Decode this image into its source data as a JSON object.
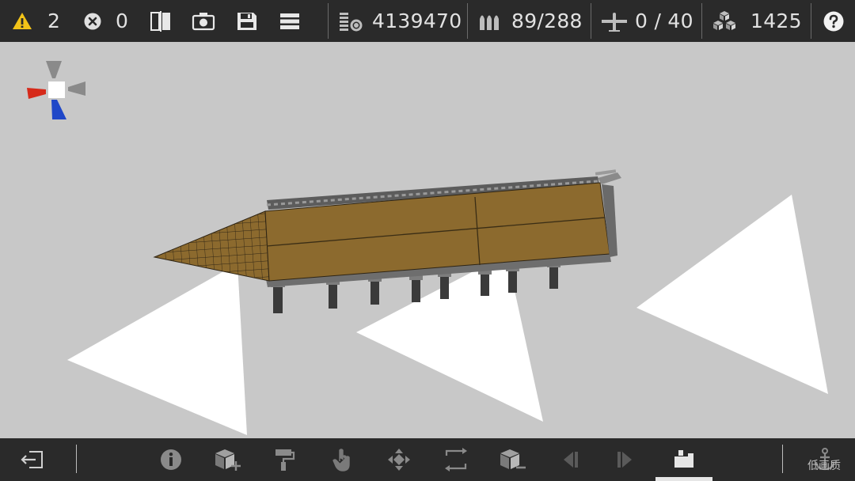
{
  "status": {
    "warnings": "2",
    "errors": "0"
  },
  "stats": {
    "cost": "4139470",
    "ammo": "89/288",
    "aircraft": "0 / 40",
    "blocks": "1425"
  },
  "toolbar_top": {
    "icons": [
      "warning-icon",
      "error-icon",
      "split-view-icon",
      "camera-icon",
      "save-icon",
      "menu-icon",
      "coins-icon",
      "ammo-icon",
      "aircraft-icon",
      "blocks-icon",
      "help-icon"
    ]
  },
  "toolbar_bottom": {
    "icons": [
      "exit-icon",
      "info-icon",
      "add-block-icon",
      "paint-roller-icon",
      "hand-select-icon",
      "move-icon",
      "rotate-icon",
      "remove-block-icon",
      "prev-icon",
      "next-icon",
      "camera-mode-icon",
      "anchor-icon"
    ],
    "active": "camera-mode-icon"
  },
  "watermark": "低画质",
  "colors": {
    "warning": "#f2c318",
    "hull": "#8c6a2e",
    "gizmo_x": "#d62a1a",
    "gizmo_z": "#1f47c8"
  }
}
